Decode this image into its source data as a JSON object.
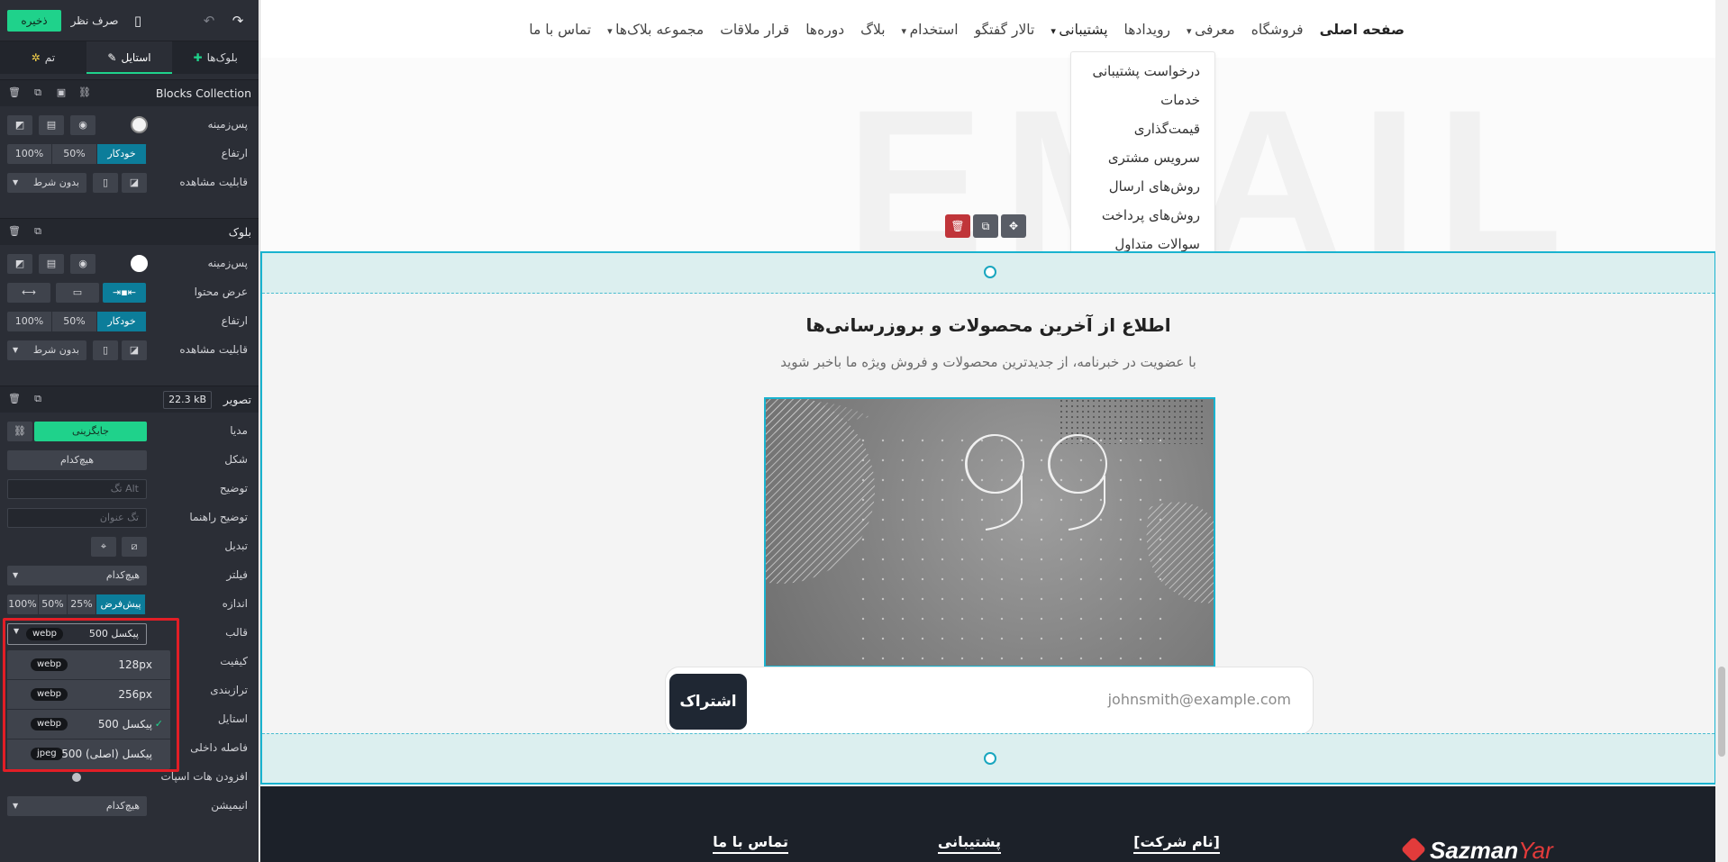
{
  "editor": {
    "save_label": "ذخیره",
    "discard_label": "صرف نظر",
    "tabs": [
      {
        "label": "بلوک‌ها"
      },
      {
        "label": "استایل"
      },
      {
        "label": "تم"
      }
    ],
    "collection": {
      "title": "Blocks Collection",
      "rows": {
        "background": "پس‌زمینه",
        "height": "ارتفاع",
        "visibility": "قابلیت مشاهده"
      },
      "height_options": [
        "خودکار",
        "50%",
        "100%"
      ],
      "visibility_value": "بدون شرط"
    },
    "block": {
      "title": "بلوک",
      "rows": {
        "background": "پس‌زمینه",
        "content_width": "عرض محتوا",
        "height": "ارتفاع",
        "visibility": "قابلیت مشاهده"
      },
      "height_options": [
        "خودکار",
        "50%",
        "100%"
      ],
      "visibility_value": "بدون شرط"
    },
    "image": {
      "title": "تصویر",
      "size_badge": "22.3 kB",
      "rows": {
        "media": "مدیا",
        "shape": "شکل",
        "description": "توضیح",
        "tooltip": "توضیح راهنما",
        "transform": "تبدیل",
        "filter": "فیلتر",
        "size": "اندازه",
        "format": "قالب",
        "quality": "کیفیت",
        "align": "ترازبندی",
        "style": "استایل",
        "padding": "فاصله داخلی",
        "hover": "افزودن هات اسپات",
        "animation": "انیمیشن"
      },
      "replace_label": "جایگزینی",
      "shape_value": "هیچ‌کدام",
      "alt_placeholder": "تگ Alt",
      "title_placeholder": "تگ عنوان",
      "filter_value": "هیچ‌کدام",
      "size_options": [
        "پیش‌فرض",
        "25%",
        "50%",
        "100%"
      ],
      "format_value": "500 پیکسل",
      "format_badge": "webp",
      "format_options": [
        {
          "label": "128px",
          "badge": "webp"
        },
        {
          "label": "256px",
          "badge": "webp"
        },
        {
          "label": "500 پیکسل",
          "badge": "webp",
          "selected": true
        },
        {
          "label": "500 پیکسل (اصلی)",
          "badge": "jpeg"
        }
      ],
      "animation_value": "هیچ‌کدام"
    }
  },
  "site": {
    "nav": [
      {
        "label": "صفحه اصلی",
        "active": true
      },
      {
        "label": "فروشگاه"
      },
      {
        "label": "معرفی",
        "dropdown": true
      },
      {
        "label": "رویدادها"
      },
      {
        "label": "پشتیبانی",
        "dropdown": true
      },
      {
        "label": "تالار گفتگو"
      },
      {
        "label": "استخدام",
        "dropdown": true
      },
      {
        "label": "بلاگ"
      },
      {
        "label": "دوره‌ها"
      },
      {
        "label": "قرار ملاقات"
      },
      {
        "label": "مجموعه بلاک‌ها",
        "dropdown": true
      },
      {
        "label": "تماس با ما"
      }
    ],
    "support_menu": [
      "درخواست پشتیبانی",
      "خدمات",
      "قیمت‌گذاری",
      "سرویس مشتری",
      "روش‌های ارسال",
      "روش‌های پرداخت",
      "سوالات متداول"
    ],
    "bg_word": "EMAIL",
    "newsletter": {
      "title": "اطلاع از آخرین محصولات و بروزرسانی‌ها",
      "subtitle": "با عضویت در خبرنامه، از جدیدترین محصولات و فروش ویژه ما باخبر شوید",
      "email_placeholder": "johnsmith@example.com",
      "subscribe_label": "اشتراک"
    },
    "footer": {
      "cols": [
        "[نام شرکت]",
        "پشتیبانی",
        "تماس با ما"
      ],
      "logo_main": "Sazman",
      "logo_accent": "Yar"
    }
  },
  "colors": {
    "accent_green": "#1fd28b",
    "accent_teal": "#0c7d9a",
    "selection": "#19b3cf",
    "highlight_red": "#e21e26"
  }
}
